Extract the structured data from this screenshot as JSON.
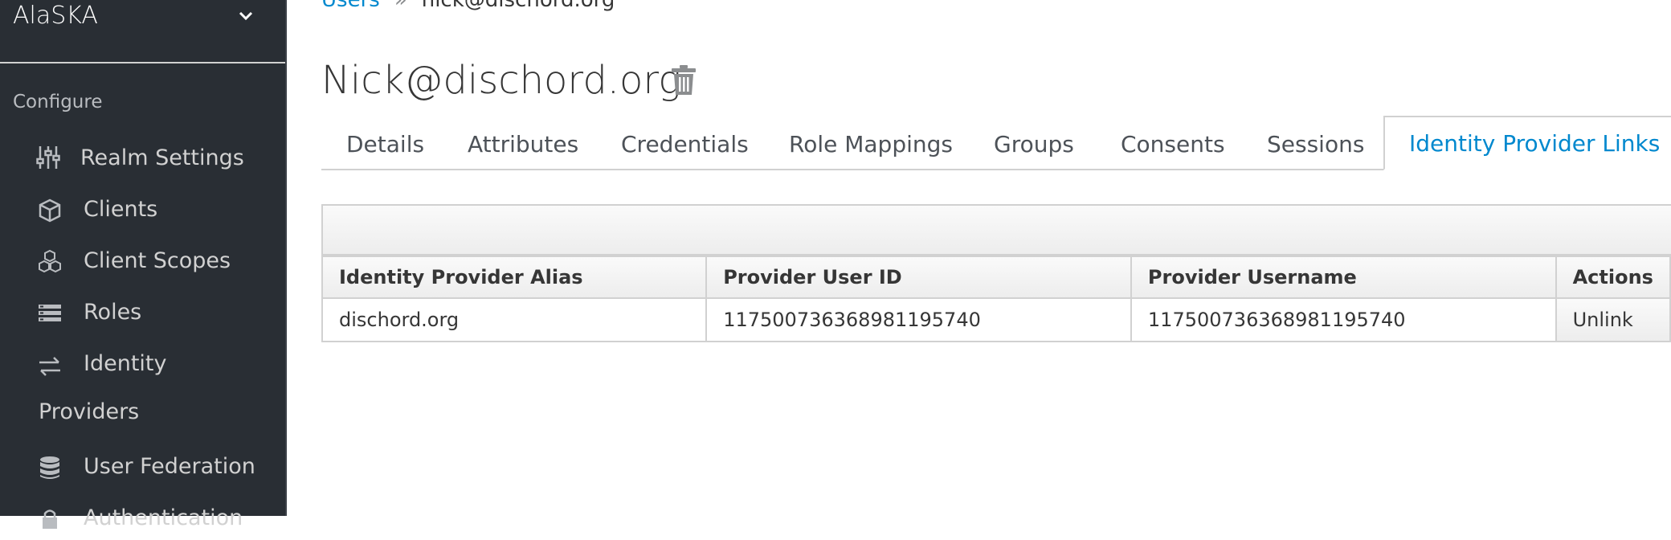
{
  "sidebar": {
    "realm": "AlaSKA",
    "section": "Configure",
    "items": [
      {
        "label": "Realm Settings",
        "icon": "sliders-icon"
      },
      {
        "label": "Clients",
        "icon": "cube-icon"
      },
      {
        "label": "Client Scopes",
        "icon": "cubes-icon"
      },
      {
        "label": "Roles",
        "icon": "list-icon"
      },
      {
        "label": "Identity",
        "label_wrap": "Providers",
        "icon": "exchange-icon"
      },
      {
        "label": "User Federation",
        "icon": "database-icon"
      },
      {
        "label": "Authentication",
        "icon": "lock-icon"
      }
    ]
  },
  "breadcrumb": {
    "parent": "Users",
    "separator": "»",
    "current": "nick@dischord.org"
  },
  "page": {
    "title": "Nick@dischord.org"
  },
  "tabs": [
    {
      "label": "Details"
    },
    {
      "label": "Attributes"
    },
    {
      "label": "Credentials"
    },
    {
      "label": "Role Mappings"
    },
    {
      "label": "Groups"
    },
    {
      "label": "Consents"
    },
    {
      "label": "Sessions"
    },
    {
      "label": "Identity Provider Links",
      "active": true
    }
  ],
  "table": {
    "columns": [
      "Identity Provider Alias",
      "Provider User ID",
      "Provider Username",
      "Actions"
    ],
    "rows": [
      {
        "alias": "dischord.org",
        "user_id": "117500736368981195740",
        "username": "117500736368981195740",
        "action": "Unlink"
      }
    ]
  },
  "colors": {
    "sidebar_bg": "#292e34",
    "accent": "#0088ce",
    "border": "#d1d1d1"
  }
}
